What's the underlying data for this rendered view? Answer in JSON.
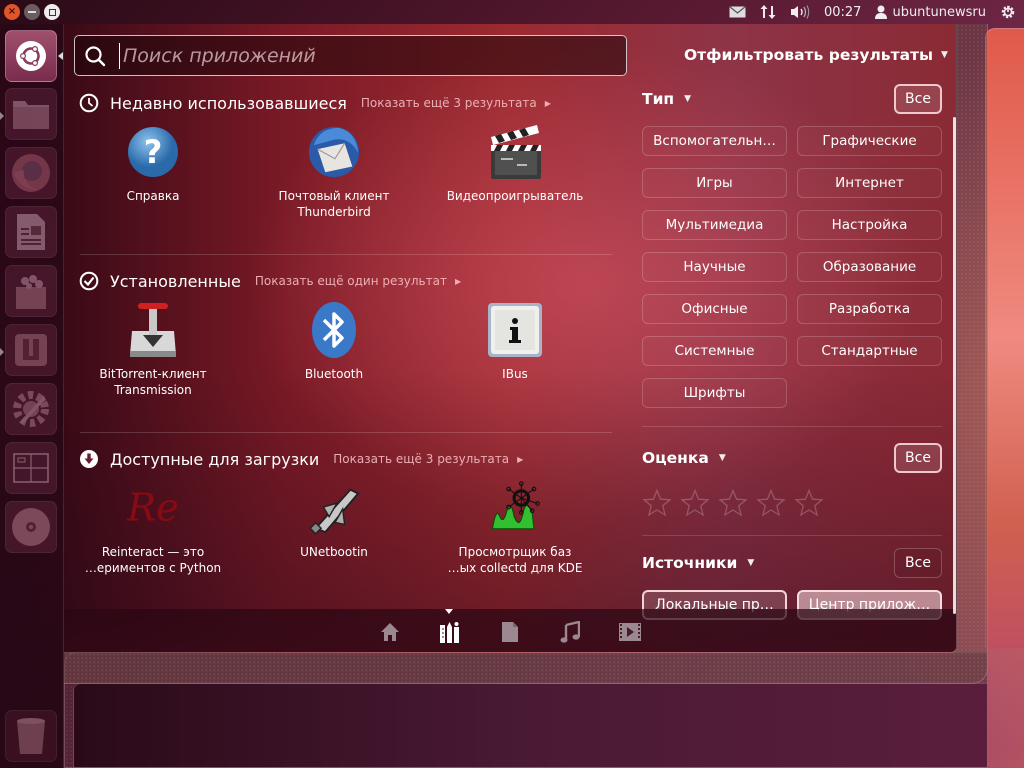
{
  "top_panel": {
    "window_controls": {
      "close": "×"
    },
    "indicators": {
      "mail_icon": "envelope-icon",
      "network_icon": "network-updown-icon",
      "sound_icon": "volume-icon",
      "clock": "00:27",
      "user_icon": "user-icon",
      "username": "ubuntunewsru",
      "session_icon": "power-gear-icon"
    }
  },
  "launcher": {
    "items": [
      {
        "name": "dash-home",
        "icon": "ubuntu-logo-icon",
        "active": true
      },
      {
        "name": "files",
        "icon": "folder-icon",
        "running": true
      },
      {
        "name": "firefox",
        "icon": "firefox-icon"
      },
      {
        "name": "libreoffice-writer",
        "icon": "document-icon"
      },
      {
        "name": "software-center",
        "icon": "shopping-bag-icon"
      },
      {
        "name": "ubuntu-one",
        "icon": "ubuntu-one-icon",
        "running": true
      },
      {
        "name": "system-settings",
        "icon": "settings-wrench-icon"
      },
      {
        "name": "workspace-switcher",
        "icon": "workspaces-icon"
      },
      {
        "name": "cd-drive",
        "icon": "disc-icon"
      },
      {
        "name": "trash",
        "icon": "trash-icon"
      }
    ]
  },
  "search": {
    "placeholder": "Поиск приложений",
    "value": ""
  },
  "filter_toggle": {
    "label": "Отфильтровать результаты"
  },
  "categories": [
    {
      "title": "Недавно использовавшиеся",
      "icon": "clock-icon",
      "more": "Показать ещё 3 результата",
      "apps": [
        {
          "label": "Справка",
          "icon": "help-icon"
        },
        {
          "label": "Почтовый клиент Thunderbird",
          "icon": "thunderbird-icon"
        },
        {
          "label": "Видеопроигрыватель",
          "icon": "clapperboard-icon"
        }
      ]
    },
    {
      "title": "Установленные",
      "icon": "check-circle-icon",
      "more": "Показать ещё один результат",
      "apps": [
        {
          "label": "BitTorrent-клиент Transmission",
          "icon": "transmission-icon"
        },
        {
          "label": "Bluetooth",
          "icon": "bluetooth-icon"
        },
        {
          "label": "IBus",
          "icon": "ibus-icon"
        }
      ]
    },
    {
      "title": "Доступные для загрузки",
      "icon": "download-circle-icon",
      "more": "Показать ещё 3 результата",
      "apps": [
        {
          "label": "Reinteract — это …ериментов с Python",
          "icon": "reinteract-icon"
        },
        {
          "label": "UNetbootin",
          "icon": "unetbootin-icon"
        },
        {
          "label": "Просмотрщик баз …ых collectd для KDE",
          "icon": "collectd-viewer-icon"
        }
      ]
    }
  ],
  "filters": {
    "type": {
      "title": "Тип",
      "all_label": "Все",
      "options": [
        "Вспомогательн…",
        "Графические",
        "Игры",
        "Интернет",
        "Мультимедиа",
        "Настройка",
        "Научные",
        "Образование",
        "Офисные",
        "Разработка",
        "Системные",
        "Стандартные",
        "Шрифты"
      ]
    },
    "rating": {
      "title": "Оценка",
      "all_label": "Все",
      "stars_total": 5,
      "stars_selected": 0
    },
    "sources": {
      "title": "Источники",
      "all_label": "Все",
      "options": [
        {
          "label": "Локальные пр…",
          "active": true
        },
        {
          "label": "Центр прилож…",
          "active": true
        }
      ]
    }
  },
  "lenses": [
    {
      "name": "home",
      "icon": "home-icon",
      "active": false
    },
    {
      "name": "applications",
      "icon": "applications-icon",
      "active": true
    },
    {
      "name": "files",
      "icon": "file-icon",
      "active": false
    },
    {
      "name": "music",
      "icon": "music-note-icon",
      "active": false
    },
    {
      "name": "video",
      "icon": "film-icon",
      "active": false
    }
  ]
}
